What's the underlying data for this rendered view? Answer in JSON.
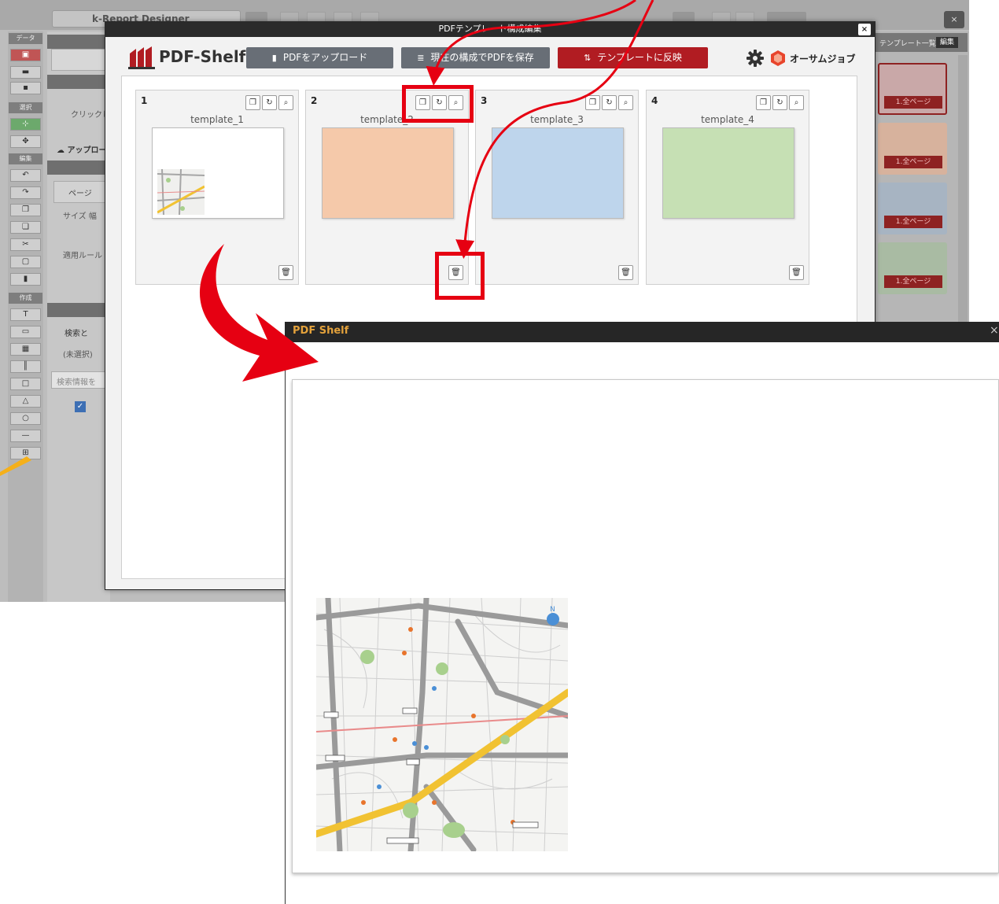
{
  "background_app": {
    "title": "k-Report Designer",
    "close_glyph": "×",
    "sections": {
      "data": "データ",
      "select": "選択",
      "edit": "編集",
      "create": "作成"
    },
    "panel": {
      "click_hint": "クリックし",
      "upload": "アップロー",
      "page": "ページ",
      "size": "サイズ 幅",
      "rule": "適用ルール",
      "search": "検索と",
      "unselected": "(未選択)",
      "search_placeholder": "検索情報を"
    },
    "template_list": {
      "header": "テンプレート一覧",
      "edit_label": "編集",
      "items": [
        {
          "label": "1.全ページ",
          "color": "#c9a8a8"
        },
        {
          "label": "1.全ページ",
          "color": "#d7b29d"
        },
        {
          "label": "1.全ページ",
          "color": "#a7b4c2"
        },
        {
          "label": "1.全ページ",
          "color": "#a9bba3"
        }
      ]
    }
  },
  "modal": {
    "title": "PDFテンプレート構成編集",
    "close_glyph": "×",
    "logo_text": "PDF-Shelf",
    "buttons": {
      "upload": "PDFをアップロード",
      "save": "現在の構成でPDFを保存",
      "reflect": "テンプレートに反映"
    },
    "brand_name": "オーサムジョブ",
    "templates": [
      {
        "number": "1",
        "name": "template_1",
        "preview": "map"
      },
      {
        "number": "2",
        "name": "template_2",
        "preview_color": "#f5c9aa"
      },
      {
        "number": "3",
        "name": "template_3",
        "preview_color": "#bed5ec"
      },
      {
        "number": "4",
        "name": "template_4",
        "preview_color": "#c6e0b4"
      }
    ]
  },
  "preview_window": {
    "title": "PDF Shelf",
    "close_glyph": "×"
  },
  "colors": {
    "accent_red": "#e60012",
    "button_gray": "#686e76",
    "button_red": "#b11c22",
    "highlight": "#e60012",
    "arrow_red": "#e60012",
    "pointer_yellow": "#f5b01a"
  }
}
